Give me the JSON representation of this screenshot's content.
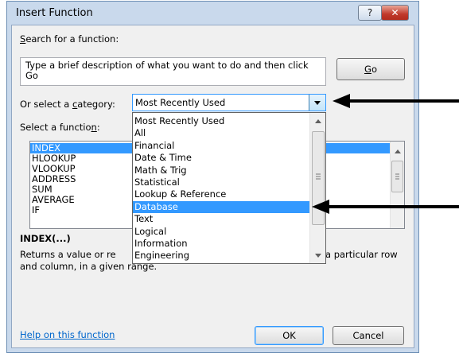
{
  "window": {
    "title": "Insert Function",
    "help_label": "?",
    "close_label": "✕"
  },
  "search": {
    "label_prefix": "",
    "label_accel": "S",
    "label_rest": "earch for a function:",
    "description": "Type a brief description of what you want to do and then click Go",
    "go_accel": "G",
    "go_rest": "o"
  },
  "category": {
    "label_prefix": "Or select a ",
    "label_accel": "c",
    "label_rest": "ategory:",
    "selected": "Most Recently Used",
    "options": [
      "Most Recently Used",
      "All",
      "Financial",
      "Date & Time",
      "Math & Trig",
      "Statistical",
      "Lookup & Reference",
      "Database",
      "Text",
      "Logical",
      "Information",
      "Engineering"
    ],
    "highlighted": "Database"
  },
  "functions": {
    "label_prefix": "Select a functio",
    "label_accel": "n",
    "label_rest": ":",
    "items": [
      "INDEX",
      "HLOOKUP",
      "VLOOKUP",
      "ADDRESS",
      "SUM",
      "AVERAGE",
      "IF"
    ],
    "selected": "INDEX"
  },
  "description": {
    "signature": "INDEX(...)",
    "text_line1_start": "Returns a value or re",
    "text_line1_end": "a particular row",
    "text_line2": "and column, in a given range."
  },
  "footer": {
    "help_link": "Help on this function",
    "ok_label": "OK",
    "cancel_label": "Cancel"
  },
  "colors": {
    "highlight": "#3399ff",
    "link": "#0066cc",
    "close_red": "#c0392b"
  },
  "icons": {
    "dropdown": "triangle-down",
    "scroll_up": "triangle-up",
    "scroll_down": "triangle-down",
    "grip": "grip-lines",
    "annotation_arrow": "arrow-left"
  }
}
